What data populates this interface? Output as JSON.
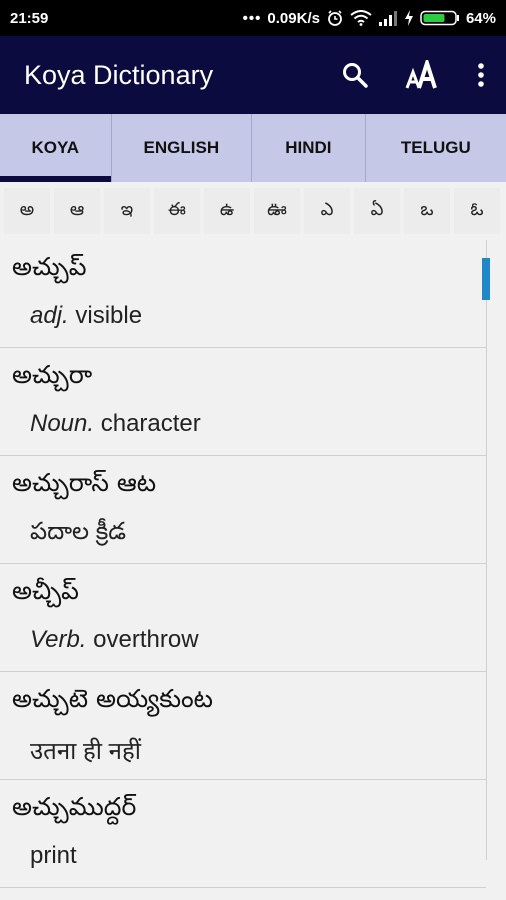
{
  "status_bar": {
    "time": "21:59",
    "dots": "•••",
    "network_speed": "0.09K/s",
    "battery": "64%"
  },
  "app_bar": {
    "title": "Koya Dictionary",
    "actions": [
      "search-icon",
      "text-size-icon",
      "more-vert-icon"
    ]
  },
  "tabs": [
    {
      "label": "KOYA",
      "active": true
    },
    {
      "label": "ENGLISH",
      "active": false
    },
    {
      "label": "HINDI",
      "active": false
    },
    {
      "label": "TELUGU",
      "active": false
    }
  ],
  "alphabet": [
    "అ",
    "ఆ",
    "ఇ",
    "ఈ",
    "ఉ",
    "ఊ",
    "ఎ",
    "ఏ",
    "ఒ",
    "ఓ"
  ],
  "entries": [
    {
      "word": "అచ్చుప్",
      "pos": "adj.",
      "meaning": " visible"
    },
    {
      "word": "అచ్చురా",
      "pos": "Noun.",
      "meaning": " character"
    },
    {
      "word": "అచ్చురాస్ ఆట",
      "pos": "",
      "meaning": "పదాల క్రీడ"
    },
    {
      "word": "అచ్చీప్",
      "pos": "Verb.",
      "meaning": " overthrow"
    },
    {
      "word": "అచ్చుటె అయ్యకుంట",
      "pos": "",
      "meaning": "उतना ही नहीं"
    },
    {
      "word": "అచ్చుముద్దర్",
      "pos": "",
      "meaning": "print"
    }
  ],
  "colors": {
    "app_bar": "#0b0b3f",
    "tab_bar": "#c5c8e6",
    "tab_indicator": "#0b0b3f",
    "scroll_thumb": "#1e88c8",
    "background": "#f1f1f1"
  }
}
